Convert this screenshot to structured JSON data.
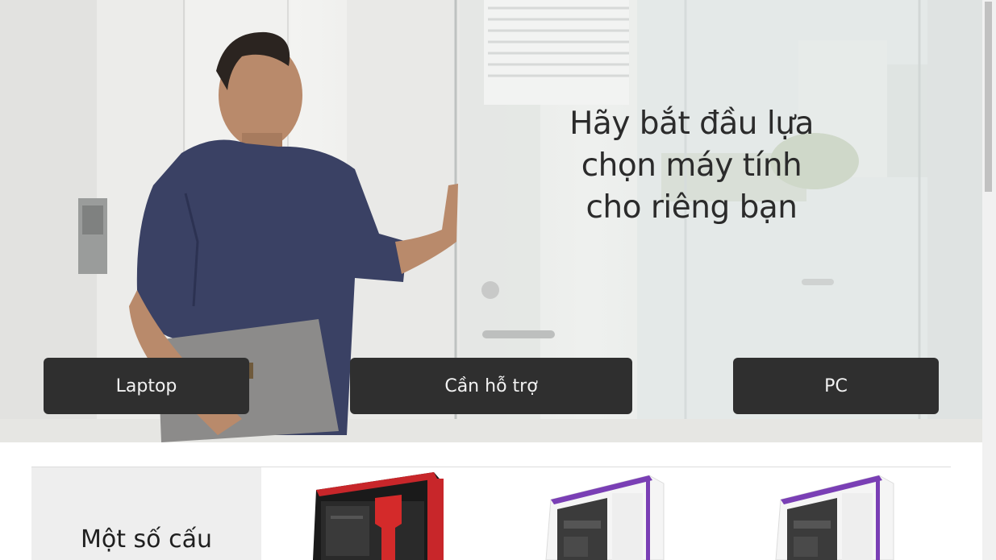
{
  "hero": {
    "title": "Hãy bắt đầu lựa chọn máy tính cho riêng bạn",
    "buttons": {
      "laptop": "Laptop",
      "support": "Cần hỗ trợ",
      "pc": "PC"
    }
  },
  "section": {
    "title": "Một số cấu"
  },
  "products": [
    {
      "name": "pc-case-red",
      "accent": "#d42a2a"
    },
    {
      "name": "pc-case-white-purple",
      "accent": "#7a3fb5"
    },
    {
      "name": "pc-case-white-purple",
      "accent": "#7a3fb5"
    }
  ],
  "colors": {
    "button_bg": "#2f2f2f",
    "button_text": "#f2f2f2",
    "title_text": "#2b2b2b",
    "side_panel_bg": "#eeeeee"
  }
}
